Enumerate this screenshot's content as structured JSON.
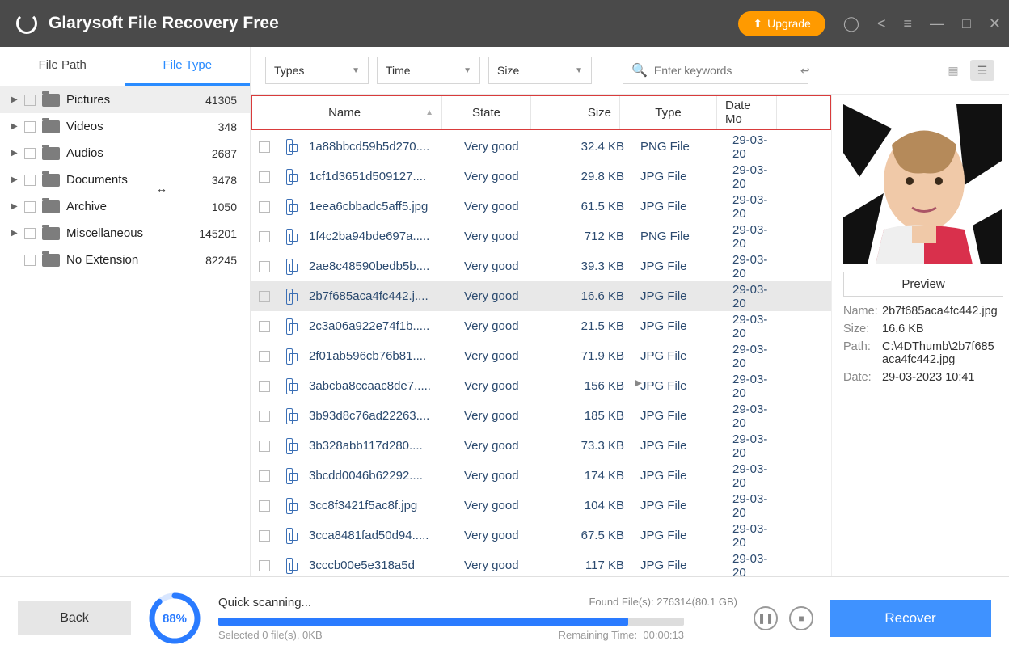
{
  "title": "Glarysoft File Recovery Free",
  "upgrade_label": "Upgrade",
  "side_tabs": {
    "file_path": "File Path",
    "file_type": "File Type"
  },
  "categories": [
    {
      "label": "Pictures",
      "count": "41305",
      "arrow": true,
      "selected": true
    },
    {
      "label": "Videos",
      "count": "348",
      "arrow": true
    },
    {
      "label": "Audios",
      "count": "2687",
      "arrow": true
    },
    {
      "label": "Documents",
      "count": "3478",
      "arrow": true
    },
    {
      "label": "Archive",
      "count": "1050",
      "arrow": true
    },
    {
      "label": "Miscellaneous",
      "count": "145201",
      "arrow": true
    },
    {
      "label": "No Extension",
      "count": "82245",
      "arrow": false
    }
  ],
  "filters": {
    "types": "Types",
    "time": "Time",
    "size": "Size"
  },
  "search": {
    "placeholder": "Enter keywords"
  },
  "columns": {
    "name": "Name",
    "state": "State",
    "size": "Size",
    "type": "Type",
    "date": "Date Mo"
  },
  "files": [
    {
      "name": "1a88bbcd59b5d270....",
      "state": "Very good",
      "size": "32.4 KB",
      "type": "PNG File",
      "date": "29-03-20"
    },
    {
      "name": "1cf1d3651d509127....",
      "state": "Very good",
      "size": "29.8 KB",
      "type": "JPG File",
      "date": "29-03-20"
    },
    {
      "name": "1eea6cbbadc5aff5.jpg",
      "state": "Very good",
      "size": "61.5 KB",
      "type": "JPG File",
      "date": "29-03-20"
    },
    {
      "name": "1f4c2ba94bde697a.....",
      "state": "Very good",
      "size": "712 KB",
      "type": "PNG File",
      "date": "29-03-20"
    },
    {
      "name": "2ae8c48590bedb5b....",
      "state": "Very good",
      "size": "39.3 KB",
      "type": "JPG File",
      "date": "29-03-20"
    },
    {
      "name": "2b7f685aca4fc442.j....",
      "state": "Very good",
      "size": "16.6 KB",
      "type": "JPG File",
      "date": "29-03-20",
      "selected": true
    },
    {
      "name": "2c3a06a922e74f1b.....",
      "state": "Very good",
      "size": "21.5 KB",
      "type": "JPG File",
      "date": "29-03-20"
    },
    {
      "name": "2f01ab596cb76b81....",
      "state": "Very good",
      "size": "71.9 KB",
      "type": "JPG File",
      "date": "29-03-20"
    },
    {
      "name": "3abcba8ccaac8de7.....",
      "state": "Very good",
      "size": "156 KB",
      "type": "JPG File",
      "date": "29-03-20"
    },
    {
      "name": "3b93d8c76ad22263....",
      "state": "Very good",
      "size": "185 KB",
      "type": "JPG File",
      "date": "29-03-20"
    },
    {
      "name": "3b328abb117d280....",
      "state": "Very good",
      "size": "73.3 KB",
      "type": "JPG File",
      "date": "29-03-20"
    },
    {
      "name": "3bcdd0046b62292....",
      "state": "Very good",
      "size": "174 KB",
      "type": "JPG File",
      "date": "29-03-20"
    },
    {
      "name": "3cc8f3421f5ac8f.jpg",
      "state": "Very good",
      "size": "104 KB",
      "type": "JPG File",
      "date": "29-03-20"
    },
    {
      "name": "3cca8481fad50d94.....",
      "state": "Very good",
      "size": "67.5 KB",
      "type": "JPG File",
      "date": "29-03-20"
    },
    {
      "name": "3cccb00e5e318a5d",
      "state": "Very good",
      "size": "117 KB",
      "type": "JPG File",
      "date": "29-03-20"
    }
  ],
  "preview": {
    "button": "Preview",
    "name_label": "Name:",
    "name_value": "2b7f685aca4fc442.jpg",
    "size_label": "Size:",
    "size_value": "16.6 KB",
    "path_label": "Path:",
    "path_value": "C:\\4DThumb\\2b7f685aca4fc442.jpg",
    "date_label": "Date:",
    "date_value": "29-03-2023 10:41"
  },
  "footer": {
    "back": "Back",
    "percent": "88%",
    "scan_title": "Quick scanning...",
    "found_label": "Found File(s):",
    "found_value": "276314(80.1 GB)",
    "selected_text": "Selected 0 file(s), 0KB",
    "remaining_label": "Remaining Time:",
    "remaining_value": "00:00:13",
    "recover": "Recover"
  }
}
